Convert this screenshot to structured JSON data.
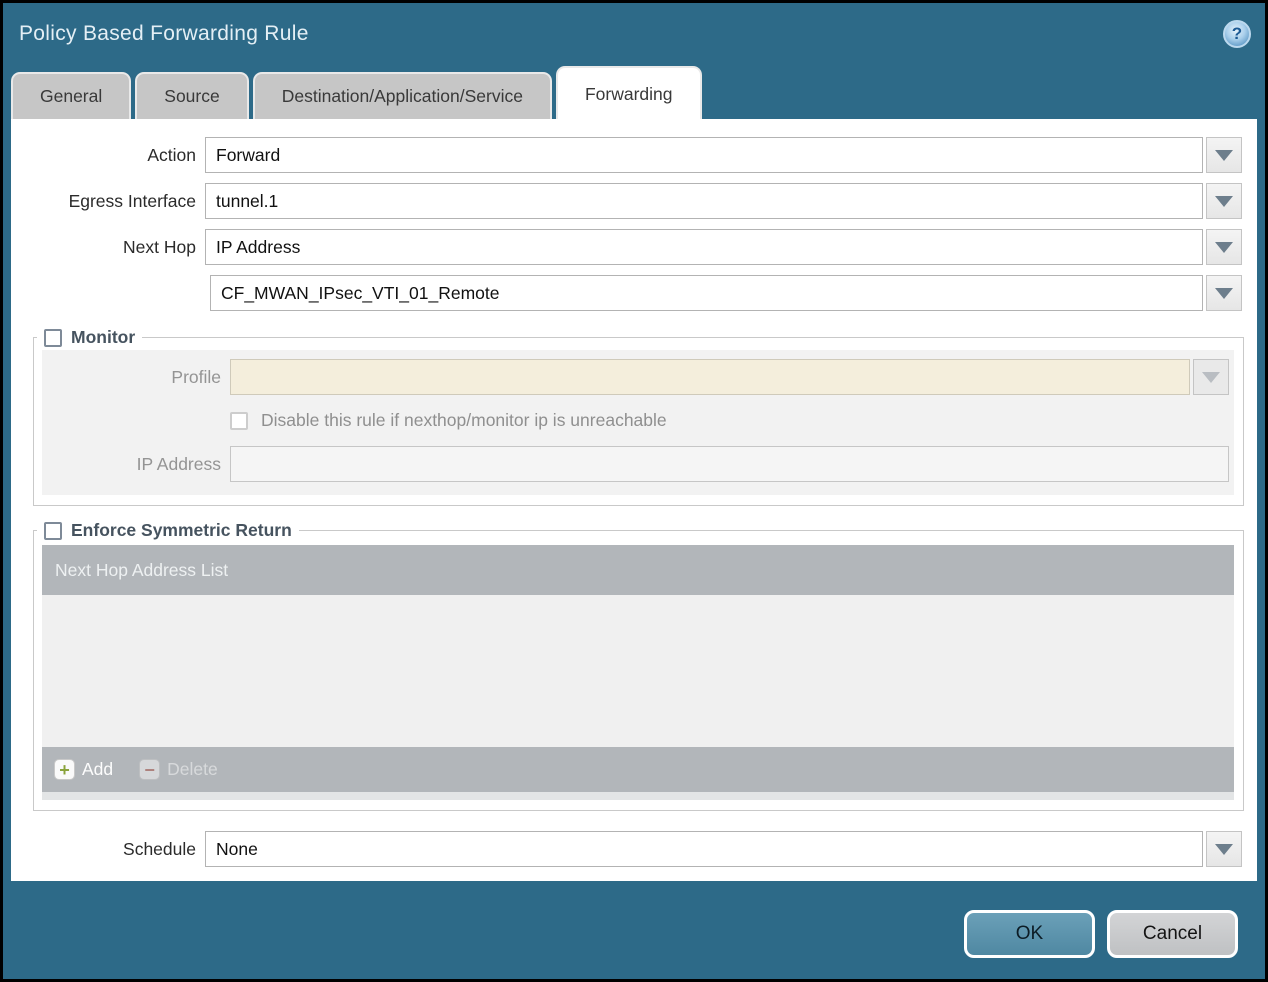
{
  "dialog": {
    "title": "Policy Based Forwarding Rule"
  },
  "icons": {
    "help": "?",
    "add": "+",
    "delete": "−"
  },
  "tabs": [
    {
      "label": "General",
      "active": false
    },
    {
      "label": "Source",
      "active": false
    },
    {
      "label": "Destination/Application/Service",
      "active": false
    },
    {
      "label": "Forwarding",
      "active": true
    }
  ],
  "form": {
    "action": {
      "label": "Action",
      "value": "Forward"
    },
    "egress_interface": {
      "label": "Egress Interface",
      "value": "tunnel.1"
    },
    "next_hop": {
      "label": "Next Hop",
      "value": "IP Address"
    },
    "next_hop_address": {
      "value": "CF_MWAN_IPsec_VTI_01_Remote"
    },
    "schedule": {
      "label": "Schedule",
      "value": "None"
    }
  },
  "monitor": {
    "legend": "Monitor",
    "checked": false,
    "profile": {
      "label": "Profile",
      "value": ""
    },
    "disable_rule": {
      "label": "Disable this rule if nexthop/monitor ip is unreachable",
      "checked": false
    },
    "ip_address": {
      "label": "IP Address",
      "value": ""
    }
  },
  "symmetric_return": {
    "legend": "Enforce Symmetric Return",
    "checked": false,
    "table": {
      "header": "Next Hop Address List",
      "rows": [],
      "add_label": "Add",
      "delete_label": "Delete"
    }
  },
  "footer": {
    "ok_label": "OK",
    "cancel_label": "Cancel"
  },
  "colors": {
    "titlebar_bg": "#2d6a88",
    "ok_button_bg": "#5e95ae",
    "disabled_field_bg": "#f4eedc",
    "section_bg": "#f2f2f2",
    "table_header_bg": "#b2b6ba",
    "add_icon_green": "#8aa33b",
    "delete_icon_red": "#a94f42"
  }
}
